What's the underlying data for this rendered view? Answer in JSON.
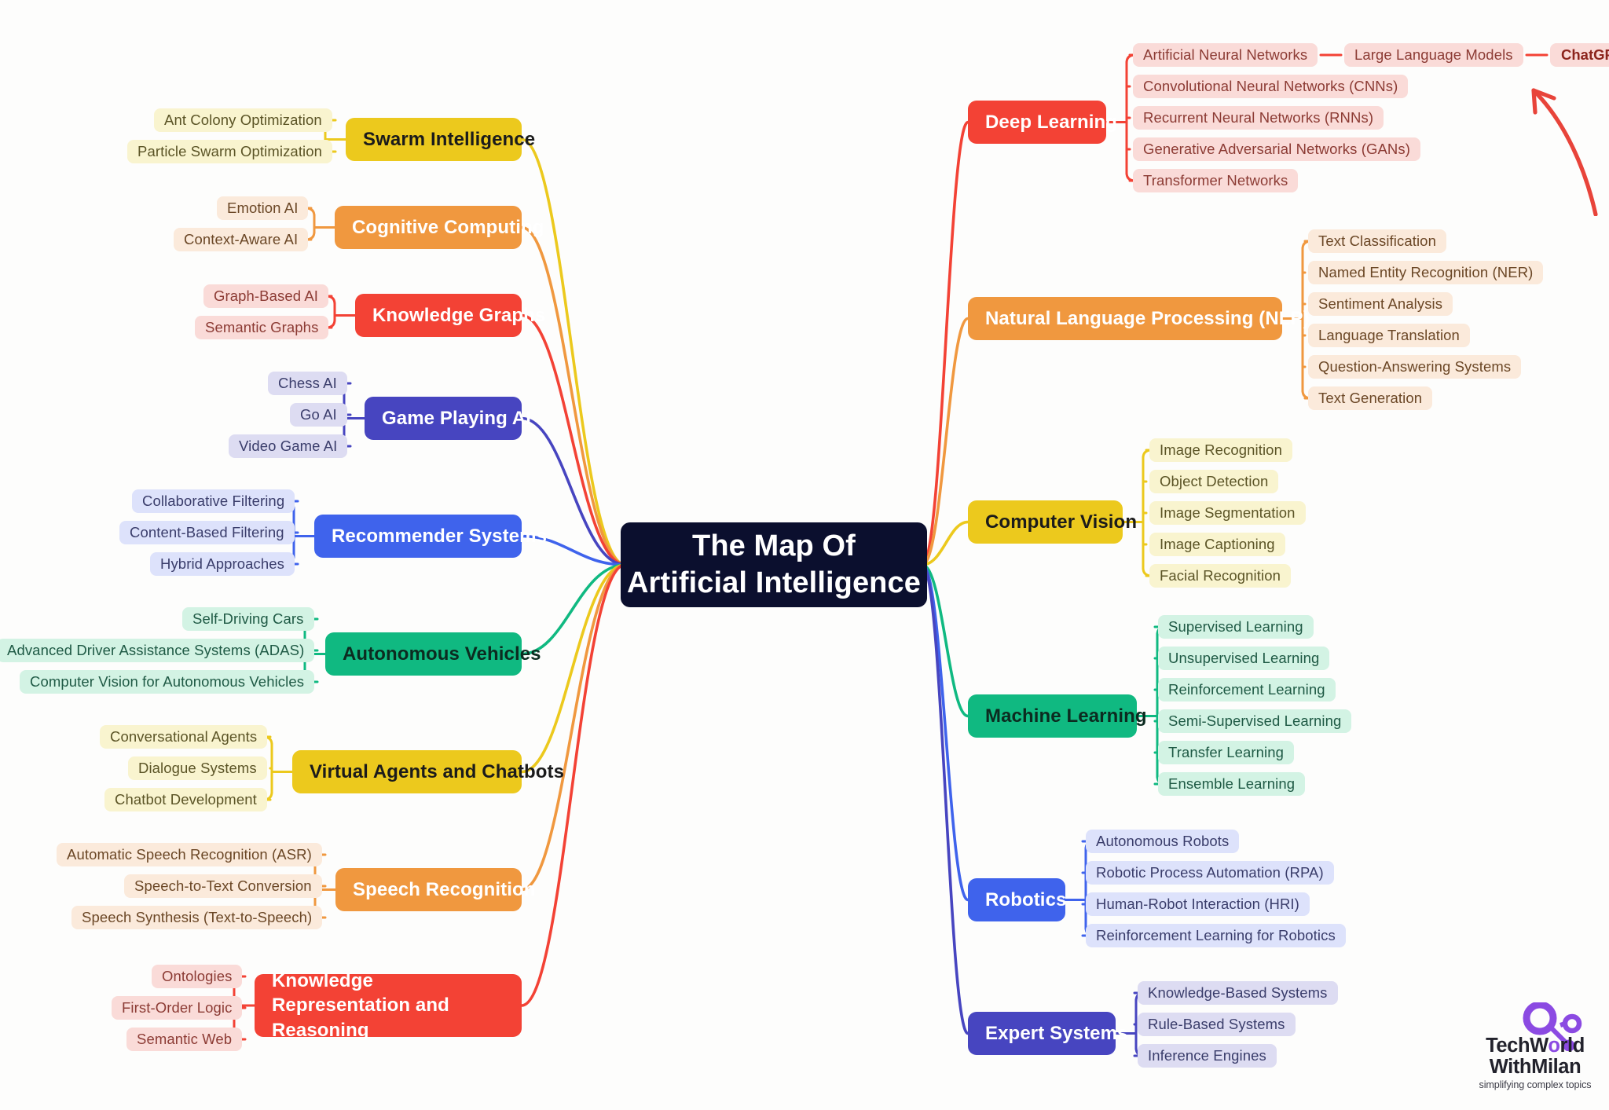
{
  "root": {
    "line1": "The Map Of",
    "line2": "Artificial Intelligence"
  },
  "annotation": {
    "label": "ChatGPT is here!",
    "arrow": "curved-arrow-icon"
  },
  "logo": {
    "name_part1": "TechW",
    "name_o": "o",
    "name_part2": "rld",
    "name_line2": "WithMilan",
    "tagline": "simplifying complex topics",
    "mark": "network-nodes-icon"
  },
  "colors": {
    "red": "#f34235",
    "red_leaf": "#fadbd8",
    "orange": "#f0983f",
    "orange_leaf": "#fbeadb",
    "yellow": "#ecc91d",
    "yellow_leaf": "#f9f4cf",
    "green": "#10b981",
    "green_leaf": "#d3f3e4",
    "blue": "#3f63ec",
    "blue_leaf": "#dde2fb",
    "indigo": "#4745c0",
    "indigo_leaf": "#dddcf2",
    "root_bg": "#0b0f2e",
    "logo_purple": "#8b4ae2"
  },
  "branches_right": [
    {
      "label": "Deep Learning",
      "color": "red",
      "children": [
        "Artificial Neural Networks",
        "Convolutional Neural Networks (CNNs)",
        "Recurrent Neural Networks (RNNs)",
        "Generative Adversarial Networks (GANs)",
        "Transformer Networks"
      ],
      "grandchildren": [
        "Large Language Models"
      ]
    },
    {
      "label": "Natural Language Processing (NLP)",
      "color": "orange",
      "children": [
        "Text Classification",
        "Named Entity Recognition (NER)",
        "Sentiment Analysis",
        "Language Translation",
        "Question-Answering Systems",
        "Text Generation"
      ]
    },
    {
      "label": "Computer Vision",
      "color": "yellow",
      "children": [
        "Image Recognition",
        "Object Detection",
        "Image Segmentation",
        "Image Captioning",
        "Facial Recognition"
      ]
    },
    {
      "label": "Machine Learning",
      "color": "green",
      "children": [
        "Supervised Learning",
        "Unsupervised Learning",
        "Reinforcement Learning",
        "Semi-Supervised Learning",
        "Transfer Learning",
        "Ensemble Learning"
      ]
    },
    {
      "label": "Robotics",
      "color": "blue",
      "children": [
        "Autonomous Robots",
        "Robotic Process Automation (RPA)",
        "Human-Robot Interaction (HRI)",
        "Reinforcement Learning for Robotics"
      ]
    },
    {
      "label": "Expert Systems",
      "color": "indigo",
      "children": [
        "Knowledge-Based Systems",
        "Rule-Based Systems",
        "Inference Engines"
      ]
    }
  ],
  "branches_left": [
    {
      "label": "Swarm Intelligence",
      "color": "yellow",
      "children": [
        "Ant Colony Optimization",
        "Particle Swarm Optimization"
      ]
    },
    {
      "label": "Cognitive Computing",
      "color": "orange",
      "children": [
        "Emotion AI",
        "Context-Aware AI"
      ]
    },
    {
      "label": "Knowledge Graphs",
      "color": "red",
      "children": [
        "Graph-Based AI",
        "Semantic Graphs"
      ]
    },
    {
      "label": "Game Playing AI",
      "color": "indigo",
      "children": [
        "Chess AI",
        "Go AI",
        "Video Game AI"
      ]
    },
    {
      "label": "Recommender Systems",
      "color": "blue",
      "children": [
        "Collaborative Filtering",
        "Content-Based Filtering",
        "Hybrid Approaches"
      ]
    },
    {
      "label": "Autonomous Vehicles",
      "color": "green",
      "children": [
        "Self-Driving Cars",
        "Advanced Driver Assistance Systems (ADAS)",
        "Computer Vision for Autonomous Vehicles"
      ]
    },
    {
      "label": "Virtual Agents and Chatbots",
      "color": "yellow",
      "children": [
        "Conversational Agents",
        "Dialogue Systems",
        "Chatbot Development"
      ]
    },
    {
      "label": "Speech Recognition",
      "color": "orange",
      "children": [
        "Automatic Speech Recognition (ASR)",
        "Speech-to-Text Conversion",
        "Speech Synthesis (Text-to-Speech)"
      ]
    },
    {
      "label": "Knowledge Representation and Reasoning",
      "color": "red",
      "children": [
        "Ontologies",
        "First-Order Logic",
        "Semantic Web"
      ]
    }
  ]
}
